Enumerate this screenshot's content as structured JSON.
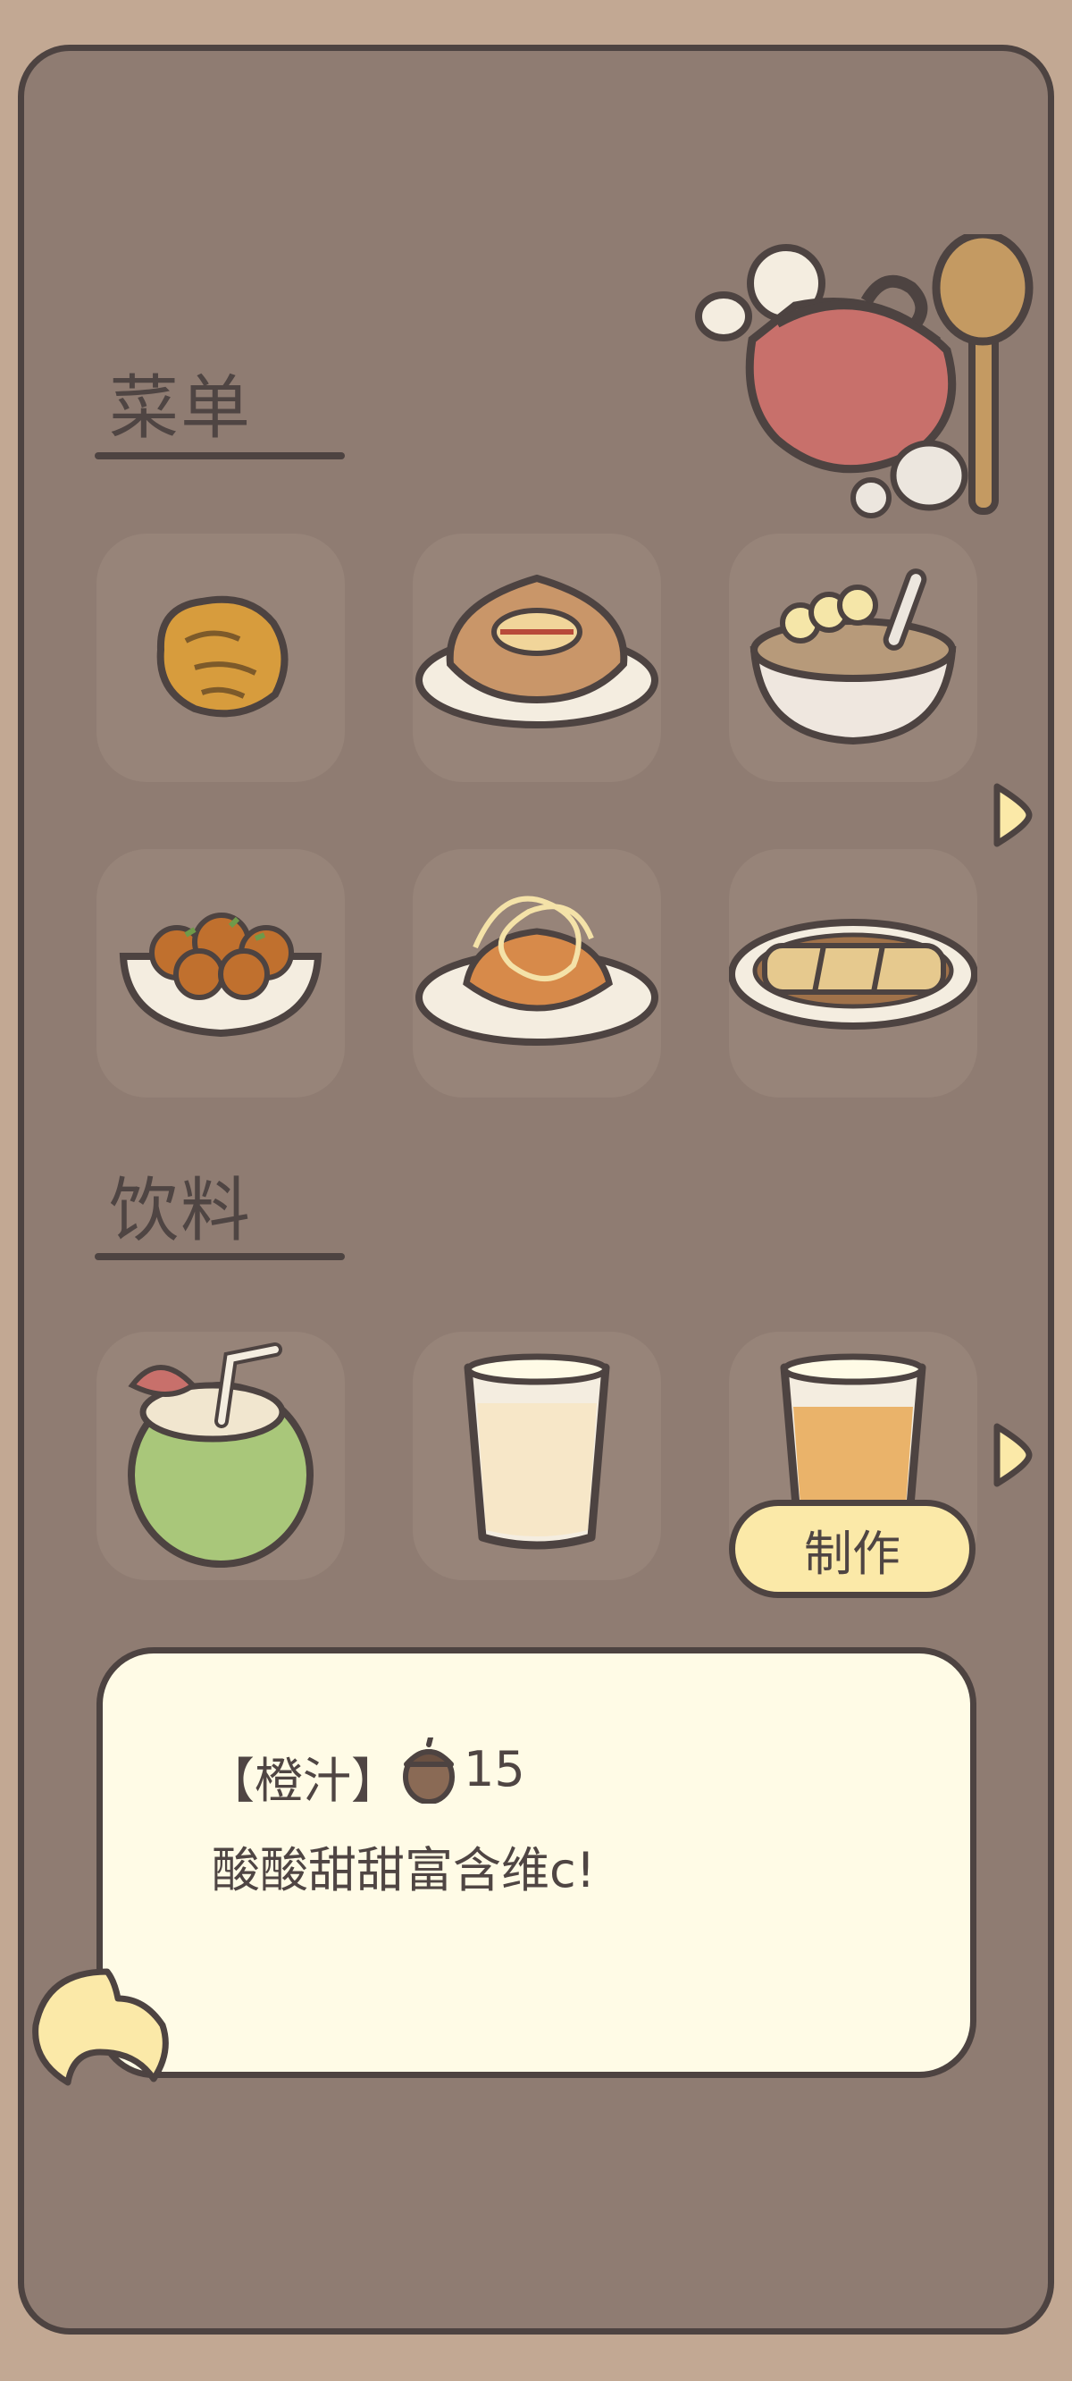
{
  "menu": {
    "food_title": "菜单",
    "drink_title": "饮料",
    "food_items": [
      {
        "icon": "hash-brown-icon"
      },
      {
        "icon": "pie-on-plate-icon"
      },
      {
        "icon": "banana-porridge-icon"
      },
      {
        "icon": "takoyaki-bowl-icon"
      },
      {
        "icon": "fried-noodles-icon"
      },
      {
        "icon": "spring-rolls-icon"
      }
    ],
    "drink_items": [
      {
        "icon": "coconut-drink-icon"
      },
      {
        "icon": "milk-glass-icon"
      },
      {
        "icon": "orange-juice-glass-icon",
        "selected": true
      }
    ]
  },
  "make_button": "制作",
  "info": {
    "name": "【橙汁】",
    "price": "15",
    "price_icon": "acorn-icon",
    "description": "酸酸甜甜富含维c!"
  },
  "colors": {
    "background": "#c2a893",
    "panel": "#8f7c72",
    "outline": "#4d4341",
    "slot": "#978479",
    "button": "#fbe9a8",
    "info_box": "#fffbe6"
  }
}
